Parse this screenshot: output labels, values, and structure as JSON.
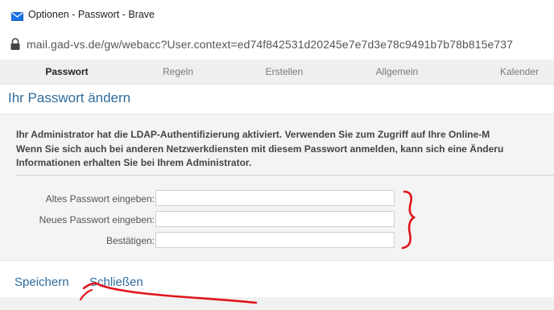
{
  "window": {
    "title": "Optionen - Passwort - Brave",
    "url": "mail.gad-vs.de/gw/webacc?User.context=ed74f842531d20245e7e7d3e78c9491b7b78b815e737"
  },
  "tabs": [
    "Passwort",
    "Regeln",
    "Erstellen",
    "Allgemein",
    "Kalender"
  ],
  "page": {
    "title": "Ihr Passwort ändern",
    "info_lines": [
      "Ihr Administrator hat die LDAP-Authentifizierung aktiviert. Verwenden Sie zum Zugriff auf Ihre Online-M",
      "Wenn Sie sich auch bei anderen Netzwerkdiensten mit diesem Passwort anmelden, kann sich eine Änderu",
      "Informationen erhalten Sie bei Ihrem Administrator."
    ]
  },
  "form": {
    "old_label": "Altes Passwort eingeben:",
    "new_label": "Neues Passwort eingeben:",
    "confirm_label": "Bestätigen:",
    "old_value": "",
    "new_value": "",
    "confirm_value": ""
  },
  "footer": {
    "save_label": "Speichern",
    "close_label": "Schließen"
  },
  "colors": {
    "accent": "#2f6c9e",
    "annotation": "#e0141c"
  }
}
